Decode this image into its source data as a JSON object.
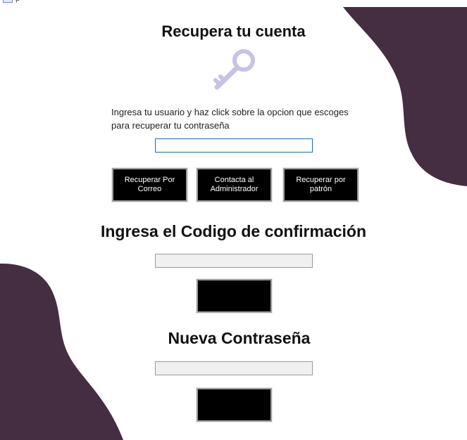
{
  "colors": {
    "accent_blob": "#452d42",
    "key_icon": "#c8c2e6",
    "button_bg": "#000000",
    "button_text": "#ffffff"
  },
  "window": {
    "icon": "app-window-icon",
    "title": "p"
  },
  "recovery": {
    "title": "Recupera tu cuenta",
    "icon": "key-icon",
    "instructions": "Ingresa tu usuario y haz click sobre la opcion que escoges para recuperar tu contraseña",
    "username_value": "",
    "buttons": {
      "email": "Recuperar Por\nCorreo",
      "admin": "Contacta al\nAdministrador",
      "pattern": "Recuperar por\npatrón"
    }
  },
  "confirmation": {
    "title": "Ingresa el Codigo de confirmación",
    "code_value": "",
    "button_label": ""
  },
  "new_password": {
    "title": "Nueva Contraseña",
    "password_value": "",
    "button_label": ""
  }
}
